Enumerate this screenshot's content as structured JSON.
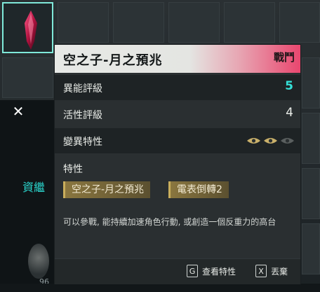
{
  "tooltip": {
    "title": "空之子-月之預兆",
    "category": "戰鬥",
    "rows": [
      {
        "label": "異能評級",
        "value": "5"
      },
      {
        "label": "活性評級",
        "value": "4"
      },
      {
        "label": "變異特性",
        "eyes_filled": 2,
        "eyes_total": 3
      }
    ],
    "traits_label": "特性",
    "traits": [
      "空之子-月之預兆",
      "電表倒轉2"
    ],
    "description": "可以參戰, 能持續加速角色行動, 或創造一個反重力的高台",
    "actions": [
      {
        "key": "G",
        "label": "查看特性"
      },
      {
        "key": "X",
        "label": "丟棄"
      }
    ]
  },
  "left_panel": {
    "partial_text": "資繼",
    "count": "96"
  },
  "colors": {
    "accent_cyan": "#35e0d7",
    "header_pink": "#e9476f",
    "trait_gold": "#8a763f",
    "eye_active": "#c9b06a",
    "eye_inactive": "#5a5f5f"
  }
}
